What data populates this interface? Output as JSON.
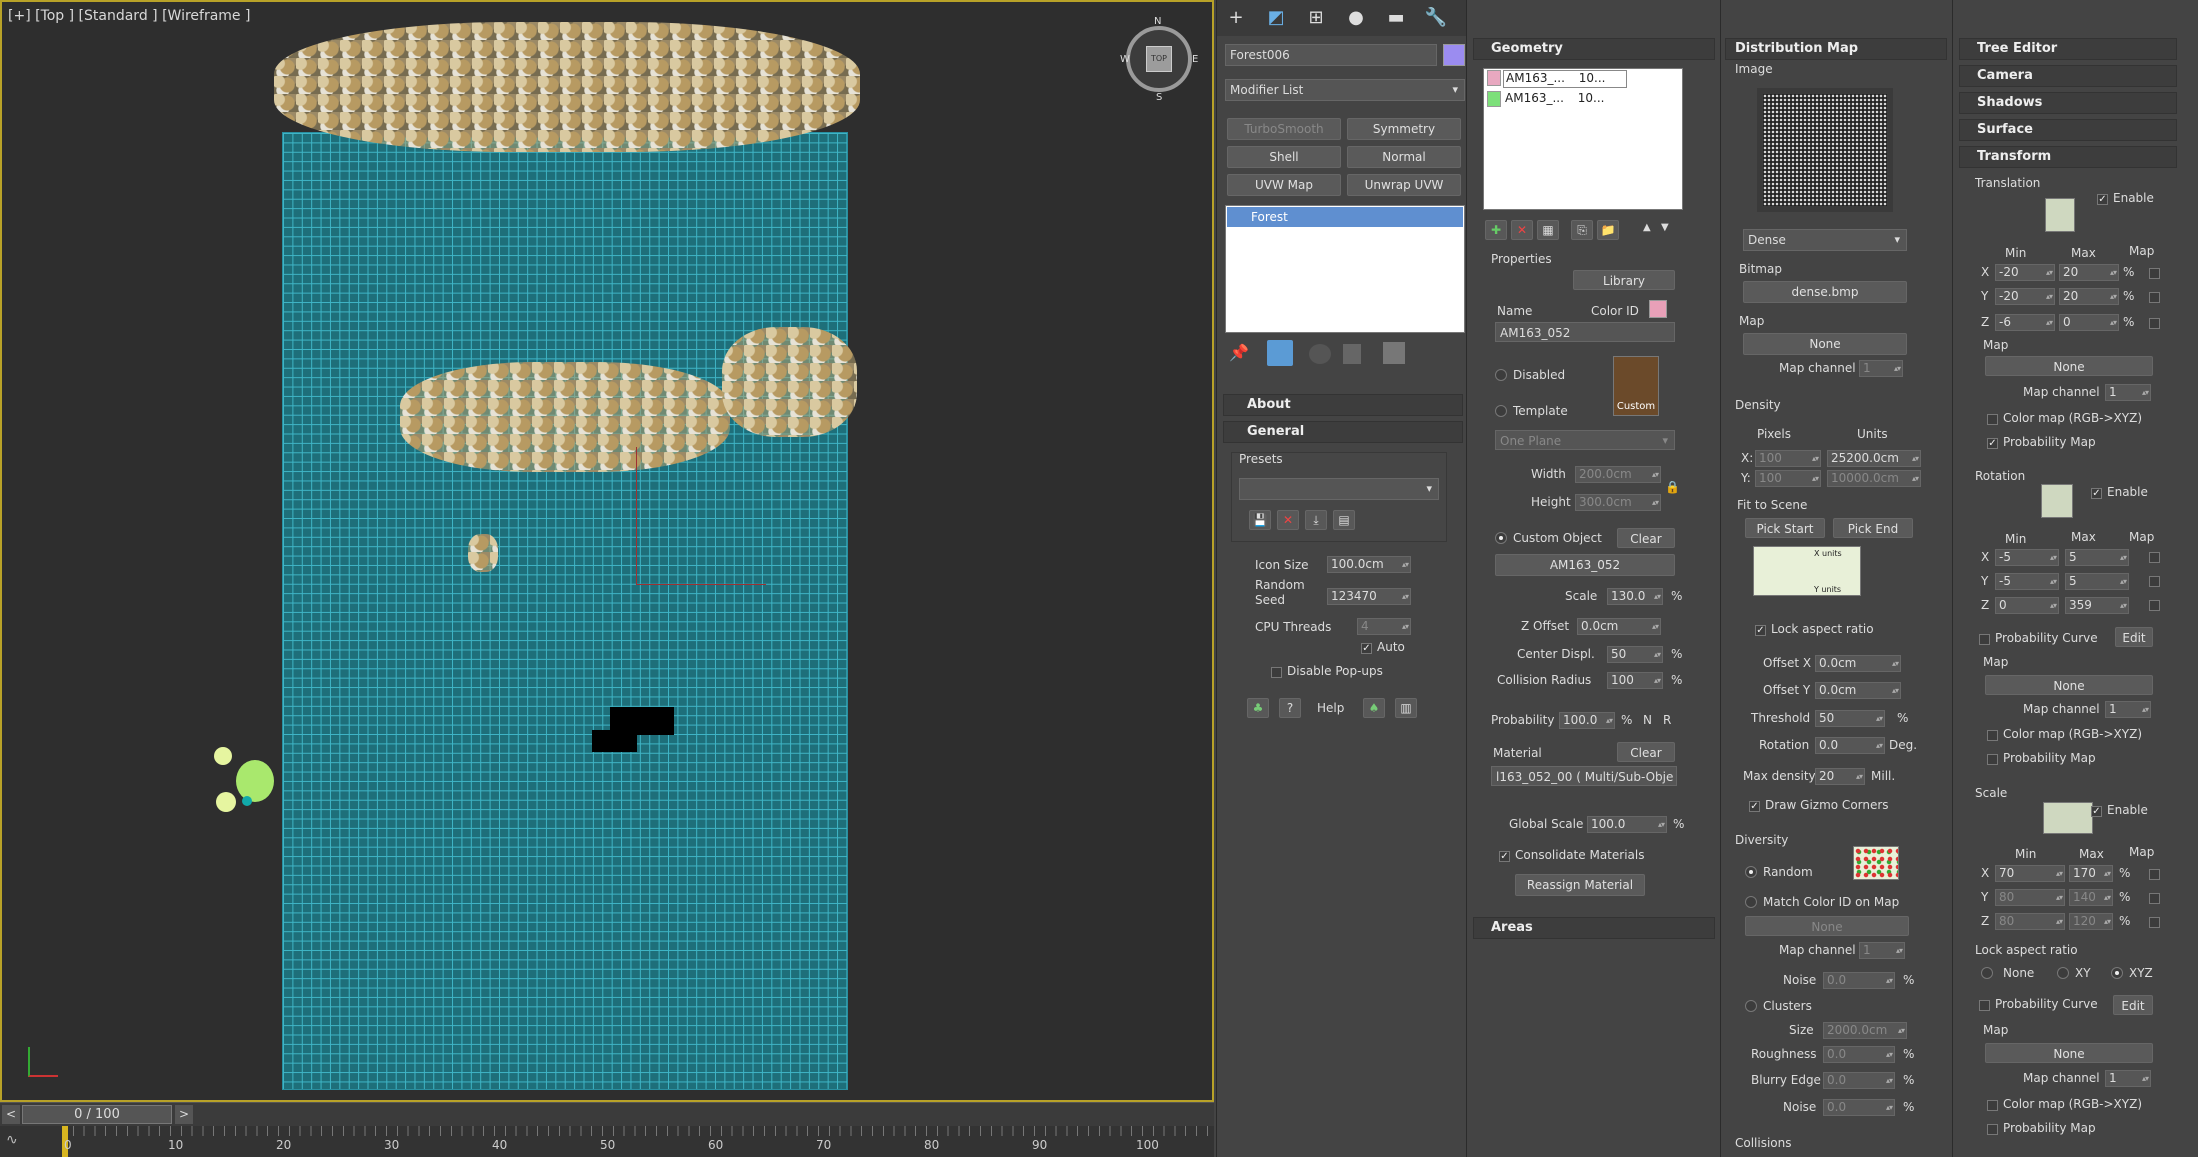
{
  "viewport": {
    "label": "[+] [Top ] [Standard ] [Wireframe ]",
    "compass": {
      "n": "N",
      "s": "S",
      "e": "E",
      "w": "W",
      "cube": "TOP"
    }
  },
  "timeline": {
    "slider": "0 / 100",
    "ticks": [
      "0",
      "10",
      "20",
      "30",
      "40",
      "50",
      "60",
      "70",
      "80",
      "90",
      "100"
    ]
  },
  "cmd": {
    "object_name": "Forest006",
    "object_color": "#9b8cf0",
    "modifier_list": "Modifier List",
    "mod_buttons": [
      "TurboSmooth",
      "Symmetry",
      "Shell",
      "Normal",
      "UVW Map",
      "Unwrap UVW"
    ],
    "stack_item": "Forest",
    "about": "About",
    "general": "General",
    "presets": "Presets",
    "icon_size_label": "Icon Size",
    "icon_size": "100.0cm",
    "random_seed_label": "Random\nSeed",
    "random_seed": "123470",
    "cpu_threads_label": "CPU Threads",
    "cpu_threads": "4",
    "auto": "Auto",
    "disable_popups": "Disable Pop-ups",
    "help": "Help"
  },
  "geometry": {
    "title": "Geometry",
    "items": [
      {
        "name": "AM163_...",
        "val": "10...",
        "color": "#e8a8c0"
      },
      {
        "name": "AM163_...",
        "val": "10...",
        "color": "#7de07a"
      }
    ],
    "properties": "Properties",
    "library": "Library",
    "name_label": "Name",
    "color_id_label": "Color ID",
    "color_id": "#e8a0b8",
    "name": "AM163_052",
    "disabled": "Disabled",
    "template": "Template",
    "custom": "Custom",
    "one_plane": "One Plane",
    "width_label": "Width",
    "width": "200.0cm",
    "height_label": "Height",
    "height": "300.0cm",
    "custom_object": "Custom Object",
    "clear": "Clear",
    "custom_obj_name": "AM163_052",
    "scale_label": "Scale",
    "scale": "130.0",
    "zoffset_label": "Z Offset",
    "zoffset": "0.0cm",
    "center_label": "Center Displ.",
    "center": "50",
    "collision_label": "Collision Radius",
    "collision": "100",
    "prob_label": "Probability",
    "prob": "100.0",
    "n": "N",
    "r": "R",
    "material_label": "Material",
    "material": "l163_052_00  ( Multi/Sub-Obje",
    "global_scale_label": "Global Scale",
    "global_scale": "100.0",
    "consolidate": "Consolidate Materials",
    "reassign": "Reassign Material",
    "areas": "Areas",
    "pct": "%"
  },
  "dist": {
    "title": "Distribution Map",
    "image": "Image",
    "dense": "Dense",
    "bitmap_label": "Bitmap",
    "bitmap": "dense.bmp",
    "map_label": "Map",
    "none": "None",
    "map_channel": "Map channel",
    "map_channel_val": "1",
    "density": "Density",
    "pixels": "Pixels",
    "units": "Units",
    "x": "X:",
    "y": "Y:",
    "px_x": "100",
    "px_y": "100",
    "u_x": "25200.0cm",
    "u_y": "10000.0cm",
    "fit": "Fit to Scene",
    "pick_start": "Pick Start",
    "pick_end": "Pick End",
    "x_units": "X units",
    "y_units": "Y units",
    "lock": "Lock aspect ratio",
    "offx_label": "Offset X",
    "offx": "0.0cm",
    "offy_label": "Offset Y",
    "offy": "0.0cm",
    "threshold_label": "Threshold",
    "threshold": "50",
    "rotation_label": "Rotation",
    "rotation": "0.0",
    "deg": "Deg.",
    "maxd_label": "Max density",
    "maxd": "20",
    "mill": "Mill.",
    "gizmo": "Draw Gizmo Corners",
    "diversity": "Diversity",
    "random": "Random",
    "match": "Match Color ID on Map",
    "noise": "Noise",
    "noise_val": "0.0",
    "clusters": "Clusters",
    "size_label": "Size",
    "size": "2000.0cm",
    "rough": "Roughness",
    "rough_val": "0.0",
    "blurry": "Blurry Edge",
    "blurry_val": "0.0",
    "noise2": "Noise",
    "noise2_val": "0.0",
    "collisions": "Collisions",
    "pct": "%"
  },
  "tree": {
    "sections": [
      "Tree Editor",
      "Camera",
      "Shadows",
      "Surface",
      "Transform"
    ],
    "translation": "Translation",
    "enable": "Enable",
    "min": "Min",
    "max": "Max",
    "map": "Map",
    "tx": [
      "-20",
      "20"
    ],
    "ty": [
      "-20",
      "20"
    ],
    "tz": [
      "-6",
      "0"
    ],
    "rotation": "Rotation",
    "rx": [
      "-5",
      "5"
    ],
    "ry": [
      "-5",
      "5"
    ],
    "rz": [
      "0",
      "359"
    ],
    "scale": "Scale",
    "sx": [
      "70",
      "170"
    ],
    "sy": [
      "80",
      "140"
    ],
    "sz": [
      "80",
      "120"
    ],
    "none": "None",
    "map_channel": "Map channel",
    "one": "1",
    "color_map": "Color map (RGB->XYZ)",
    "prob_map": "Probability Map",
    "prob_curve": "Probability Curve",
    "edit": "Edit",
    "lock": "Lock aspect ratio",
    "lock_none": "None",
    "lock_xy": "XY",
    "lock_xyz": "XYZ",
    "X": "X",
    "Y": "Y",
    "Z": "Z",
    "pct": "%"
  }
}
